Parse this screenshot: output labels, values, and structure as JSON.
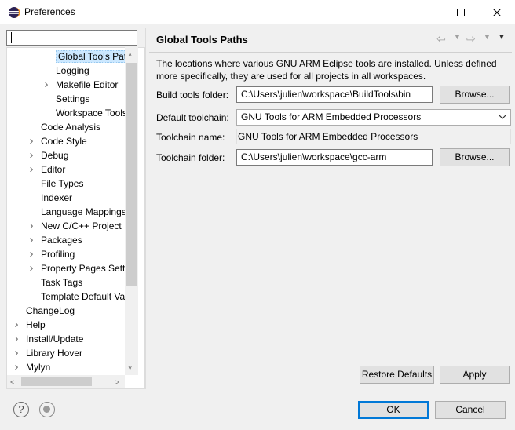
{
  "window": {
    "title": "Preferences"
  },
  "filter": {
    "value": "",
    "placeholder": ""
  },
  "tree": [
    {
      "label": "Global Tools Path",
      "selected": true,
      "expander": ""
    },
    {
      "label": "Logging",
      "expander": ""
    },
    {
      "label": "Makefile Editor",
      "expander": "collapsed"
    },
    {
      "label": "Settings",
      "expander": ""
    },
    {
      "label": "Workspace Tools",
      "expander": ""
    },
    {
      "label": "Code Analysis",
      "expander": ""
    },
    {
      "label": "Code Style",
      "expander": "collapsed"
    },
    {
      "label": "Debug",
      "expander": "collapsed"
    },
    {
      "label": "Editor",
      "expander": "collapsed"
    },
    {
      "label": "File Types",
      "expander": ""
    },
    {
      "label": "Indexer",
      "expander": ""
    },
    {
      "label": "Language Mappings",
      "expander": ""
    },
    {
      "label": "New C/C++ Project",
      "expander": "collapsed"
    },
    {
      "label": "Packages",
      "expander": "collapsed"
    },
    {
      "label": "Profiling",
      "expander": "collapsed"
    },
    {
      "label": "Property Pages Setti",
      "expander": "collapsed"
    },
    {
      "label": "Task Tags",
      "expander": ""
    },
    {
      "label": "Template Default Va",
      "expander": ""
    },
    {
      "label": "ChangeLog",
      "expander": ""
    },
    {
      "label": "Help",
      "expander": "collapsed"
    },
    {
      "label": "Install/Update",
      "expander": "collapsed"
    },
    {
      "label": "Library Hover",
      "expander": "collapsed"
    },
    {
      "label": "Mylyn",
      "expander": "collapsed"
    }
  ],
  "page": {
    "title": "Global Tools Paths",
    "description": "The locations where various GNU ARM Eclipse tools are installed. Unless defined more specifically, they are used for all projects in all workspaces.",
    "build_tools_label": "Build tools folder:",
    "build_tools_value": "C:\\Users\\julien\\workspace\\BuildTools\\bin",
    "browse_label": "Browse...",
    "default_toolchain_label": "Default toolchain:",
    "default_toolchain_value": "GNU Tools for ARM Embedded Processors",
    "toolchain_name_label": "Toolchain name:",
    "toolchain_name_value": "GNU Tools for ARM Embedded Processors",
    "toolchain_folder_label": "Toolchain folder:",
    "toolchain_folder_value": "C:\\Users\\julien\\workspace\\gcc-arm",
    "restore_defaults_label": "Restore Defaults",
    "apply_label": "Apply"
  },
  "footer": {
    "ok_label": "OK",
    "cancel_label": "Cancel"
  },
  "icons": {
    "app": "eclipse-icon",
    "help": "help-icon",
    "record": "record-icon"
  },
  "colors": {
    "selection": "#cce8ff",
    "default_button_border": "#0078d7",
    "eclipse_purple": "#2c2255"
  }
}
